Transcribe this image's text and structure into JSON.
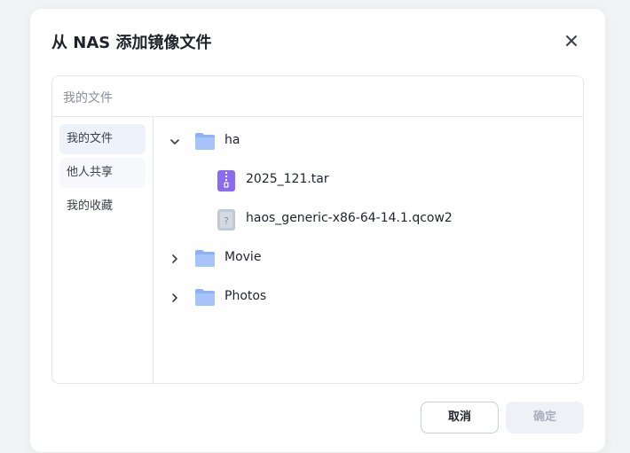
{
  "dialog": {
    "title": "从 NAS 添加镜像文件",
    "path": "我的文件",
    "cancel_label": "取消",
    "ok_label": "确定"
  },
  "sidebar": {
    "items": [
      {
        "label": "我的文件",
        "active": true
      },
      {
        "label": "他人共享",
        "active": false
      },
      {
        "label": "我的收藏",
        "active": false
      }
    ]
  },
  "tree": {
    "items": [
      {
        "name": "ha",
        "type": "folder",
        "expanded": true,
        "icon": "folder-icon"
      },
      {
        "name": "2025_121.tar",
        "type": "archive",
        "icon": "archive-file-icon"
      },
      {
        "name": "haos_generic-x86-64-14.1.qcow2",
        "type": "unknown",
        "icon": "unknown-file-icon"
      },
      {
        "name": "Movie",
        "type": "folder",
        "expanded": false,
        "icon": "folder-icon"
      },
      {
        "name": "Photos",
        "type": "folder",
        "expanded": false,
        "icon": "folder-icon"
      }
    ]
  },
  "colors": {
    "folder": "#8fb2f5",
    "archive": "#8b6cf0",
    "active_bg": "#eef2fa",
    "disabled_btn_bg": "#eef1f6"
  }
}
